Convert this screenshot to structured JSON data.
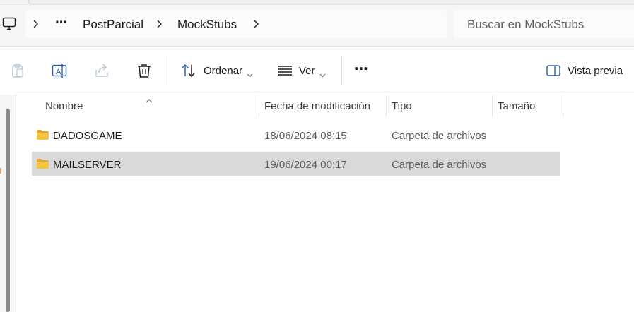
{
  "breadcrumb": {
    "overflow": "⋯",
    "items": [
      "PostParcial",
      "MockStubs"
    ]
  },
  "search": {
    "placeholder": "Buscar en MockStubs"
  },
  "toolbar": {
    "sort_label": "Ordenar",
    "view_label": "Ver",
    "more_label": "⋯",
    "preview_label": "Vista previa"
  },
  "columns": {
    "name": "Nombre",
    "modified": "Fecha de modificación",
    "type": "Tipo",
    "size": "Tamaño"
  },
  "files": [
    {
      "name": "DADOSGAME",
      "modified": "18/06/2024 08:15",
      "type": "Carpeta de archivos",
      "size": "",
      "selected": false
    },
    {
      "name": "MAILSERVER",
      "modified": "19/06/2024 00:17",
      "type": "Carpeta de archivos",
      "size": "",
      "selected": true
    }
  ],
  "colors": {
    "accent_blue": "#2a5fa8",
    "folder_yellow": "#f4c542",
    "selected_row": "#d9d9d9"
  },
  "icons": {
    "computer": "computer-icon",
    "copy": "clipboard-icon",
    "rename": "rename-icon",
    "share": "share-icon",
    "delete": "trash-icon",
    "sort": "sort-icon",
    "view": "view-icon",
    "preview": "preview-pane-icon",
    "folder": "folder-icon"
  }
}
